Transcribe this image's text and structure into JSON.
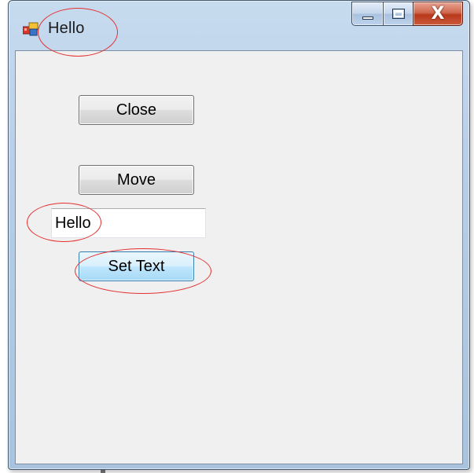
{
  "window": {
    "title": "Hello",
    "app_icon": "form-app-icon",
    "caption_buttons": {
      "minimize_icon": "minimize-icon",
      "maximize_icon": "maximize-icon",
      "close_glyph": "X"
    }
  },
  "form": {
    "close_button_label": "Close",
    "move_button_label": "Move",
    "text_field_value": "Hello",
    "set_text_button_label": "Set Text"
  },
  "colors": {
    "annotation": "#e53030",
    "client_background": "#f0f0f0",
    "close_button_red": "#c4462a"
  }
}
